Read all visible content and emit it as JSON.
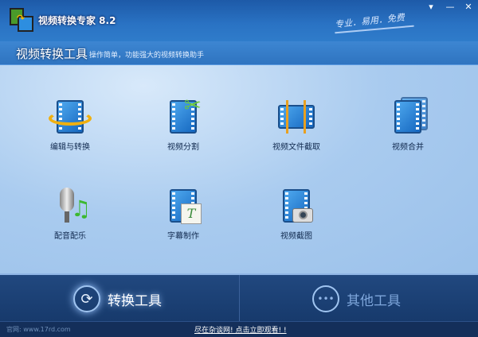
{
  "app": {
    "title": "视频转换专家 8.2",
    "slogan": "专业．易用．免费"
  },
  "window": {
    "menu": "▾",
    "minimize": "—",
    "close": "✕"
  },
  "header": {
    "title": "视频转换工具",
    "description": "操作简单，功能强大的视频转换助手"
  },
  "tools": [
    {
      "label": "编辑与转换",
      "icon": "edit-convert-icon"
    },
    {
      "label": "视频分割",
      "icon": "scissors-film-icon"
    },
    {
      "label": "视频文件截取",
      "icon": "film-trim-icon"
    },
    {
      "label": "视频合并",
      "icon": "film-merge-icon"
    },
    {
      "label": "配音配乐",
      "icon": "microphone-music-icon"
    },
    {
      "label": "字幕制作",
      "icon": "subtitle-icon"
    },
    {
      "label": "视频截图",
      "icon": "camera-film-icon"
    }
  ],
  "bottom": {
    "convert_label": "转换工具",
    "other_label": "其他工具"
  },
  "footer": {
    "site": "官网: www.17rd.com",
    "promo": "尽在杂谈网! 点击立即观看! !"
  },
  "colors": {
    "accent": "#2a73c4",
    "bottom": "#1c4276"
  }
}
